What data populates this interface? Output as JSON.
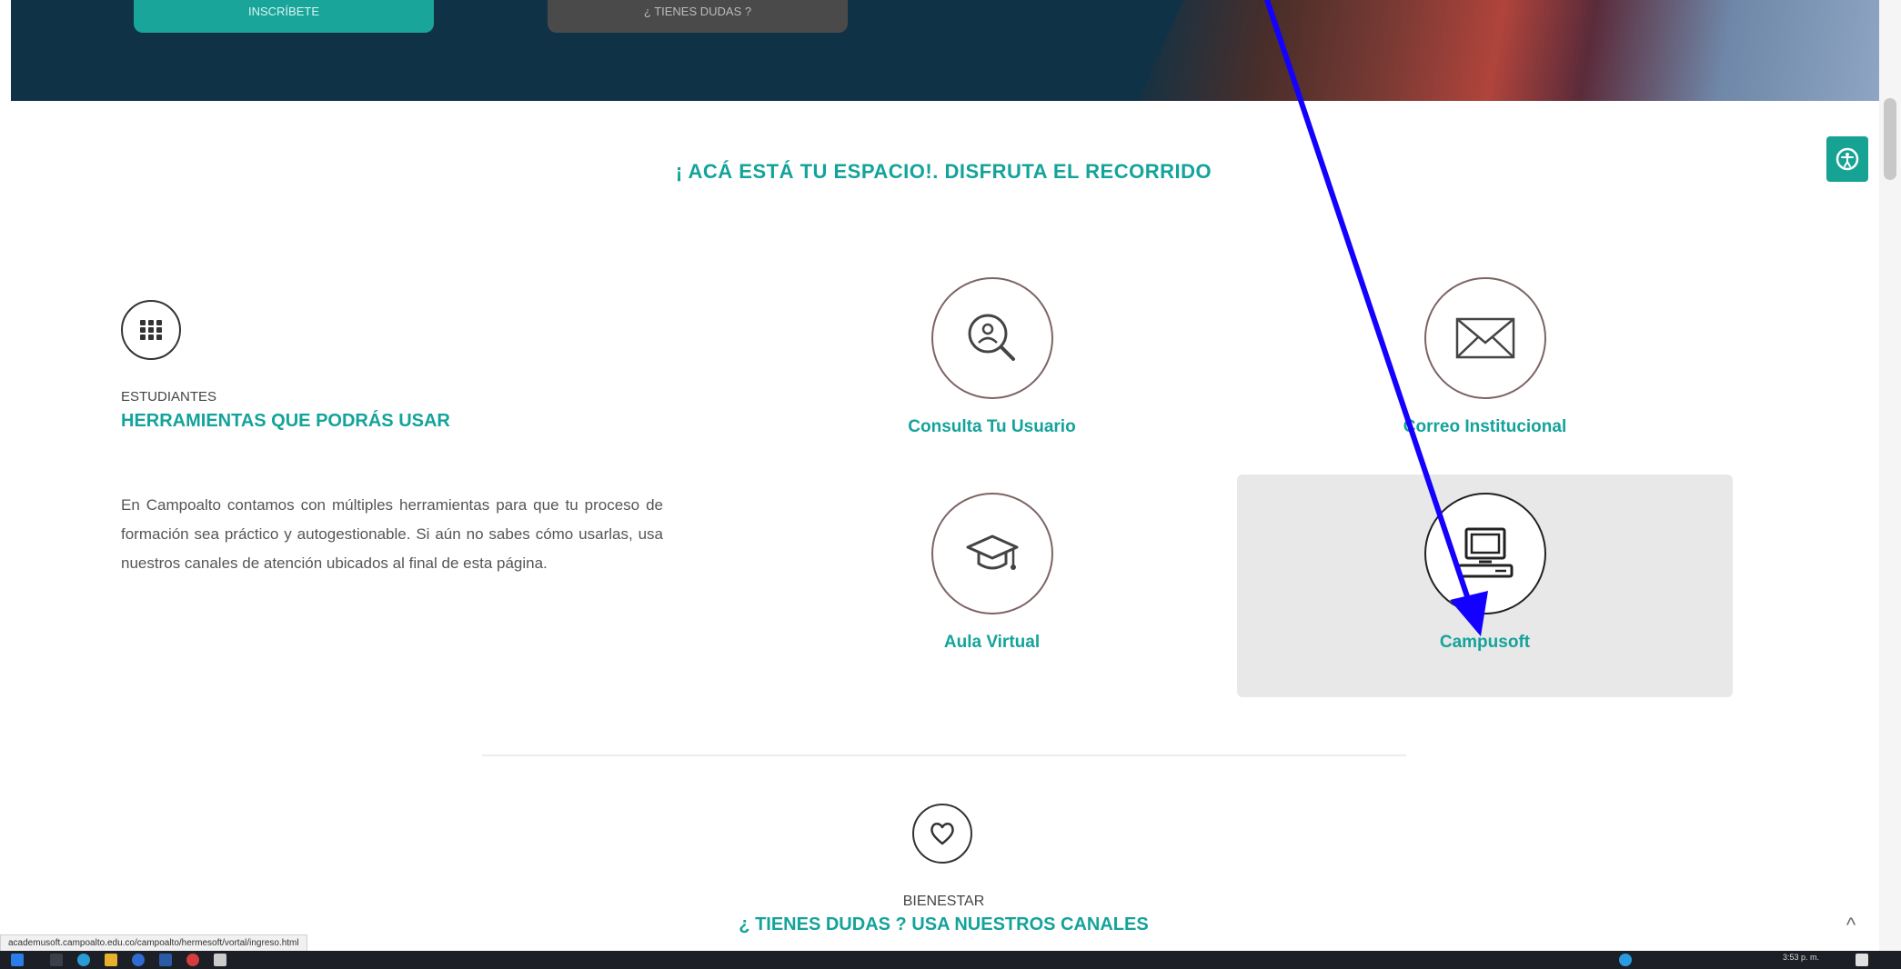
{
  "hero": {
    "button_1_label": "INSCRÍBETE",
    "button_2_label": "¿ TIENES DUDAS ?"
  },
  "section": {
    "heading": "¡ ACÁ ESTÁ TU ESPACIO!. DISFRUTA EL RECORRIDO"
  },
  "students": {
    "label": "ESTUDIANTES",
    "title": "HERRAMIENTAS QUE PODRÁS USAR",
    "description": "En Campoalto contamos con múltiples herramientas para que tu proceso de formación sea práctico y autogestionable. Si aún no sabes cómo usarlas, usa nuestros canales de atención ubicados al final de esta página."
  },
  "tools": [
    {
      "label": "Consulta Tu Usuario",
      "icon": "user-search-icon"
    },
    {
      "label": "Correo Institucional",
      "icon": "envelope-icon"
    },
    {
      "label": "Aula Virtual",
      "icon": "graduation-cap-icon"
    },
    {
      "label": "Campusoft",
      "icon": "computer-icon",
      "hovered": true
    }
  ],
  "bienestar": {
    "label": "BIENESTAR",
    "title": "¿ TIENES DUDAS ? USA NUESTROS CANALES"
  },
  "status_bar": {
    "url": "academusoft.campoalto.edu.co/campoalto/hermesoft/vortal/ingreso.html"
  },
  "taskbar": {
    "clock": "3:53 p. m."
  },
  "colors": {
    "accent": "#14a39a",
    "hero_bg": "#0f3246",
    "annotation": "#1400ff"
  }
}
